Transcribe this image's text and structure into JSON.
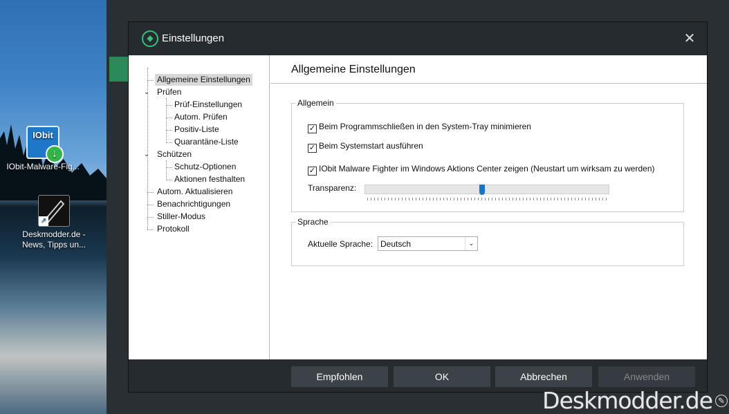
{
  "desktop": {
    "icons": [
      {
        "label": "IObit-Malware-Fig...",
        "badge": "IObit"
      },
      {
        "label": "Deskmodder.de - News, Tipps un..."
      }
    ]
  },
  "dialog": {
    "title": "Einstellungen",
    "close_glyph": "✕"
  },
  "nav": {
    "items": [
      {
        "label": "Allgemeine Einstellungen"
      },
      {
        "label": "Prüfen"
      },
      {
        "label": "Prüf-Einstellungen"
      },
      {
        "label": "Autom. Prüfen"
      },
      {
        "label": "Positiv-Liste"
      },
      {
        "label": "Quarantäne-Liste"
      },
      {
        "label": "Schützen"
      },
      {
        "label": "Schutz-Optionen"
      },
      {
        "label": "Aktionen festhalten"
      },
      {
        "label": "Autom. Aktualisieren"
      },
      {
        "label": "Benachrichtigungen"
      },
      {
        "label": "Stiller-Modus"
      },
      {
        "label": "Protokoll"
      }
    ]
  },
  "content": {
    "title": "Allgemeine Einstellungen",
    "allgemein": {
      "label": "Allgemein",
      "checks": [
        {
          "label": "Beim Programmschließen in den System-Tray minimieren",
          "checked": true
        },
        {
          "label": "Beim Systemstart ausführen",
          "checked": true
        },
        {
          "label": "IObit Malware Fighter im Windows Aktions Center zeigen (Neustart um wirksam zu werden)",
          "checked": true
        }
      ],
      "transparency_label": "Transparenz:",
      "transparency_value": 0.48
    },
    "sprache": {
      "label": "Sprache",
      "current_label": "Aktuelle Sprache:",
      "current_value": "Deutsch"
    }
  },
  "footer": {
    "empfohlen": "Empfohlen",
    "ok": "OK",
    "abbrechen": "Abbrechen",
    "anwenden": "Anwenden"
  },
  "watermark": "Deskmodder.de"
}
